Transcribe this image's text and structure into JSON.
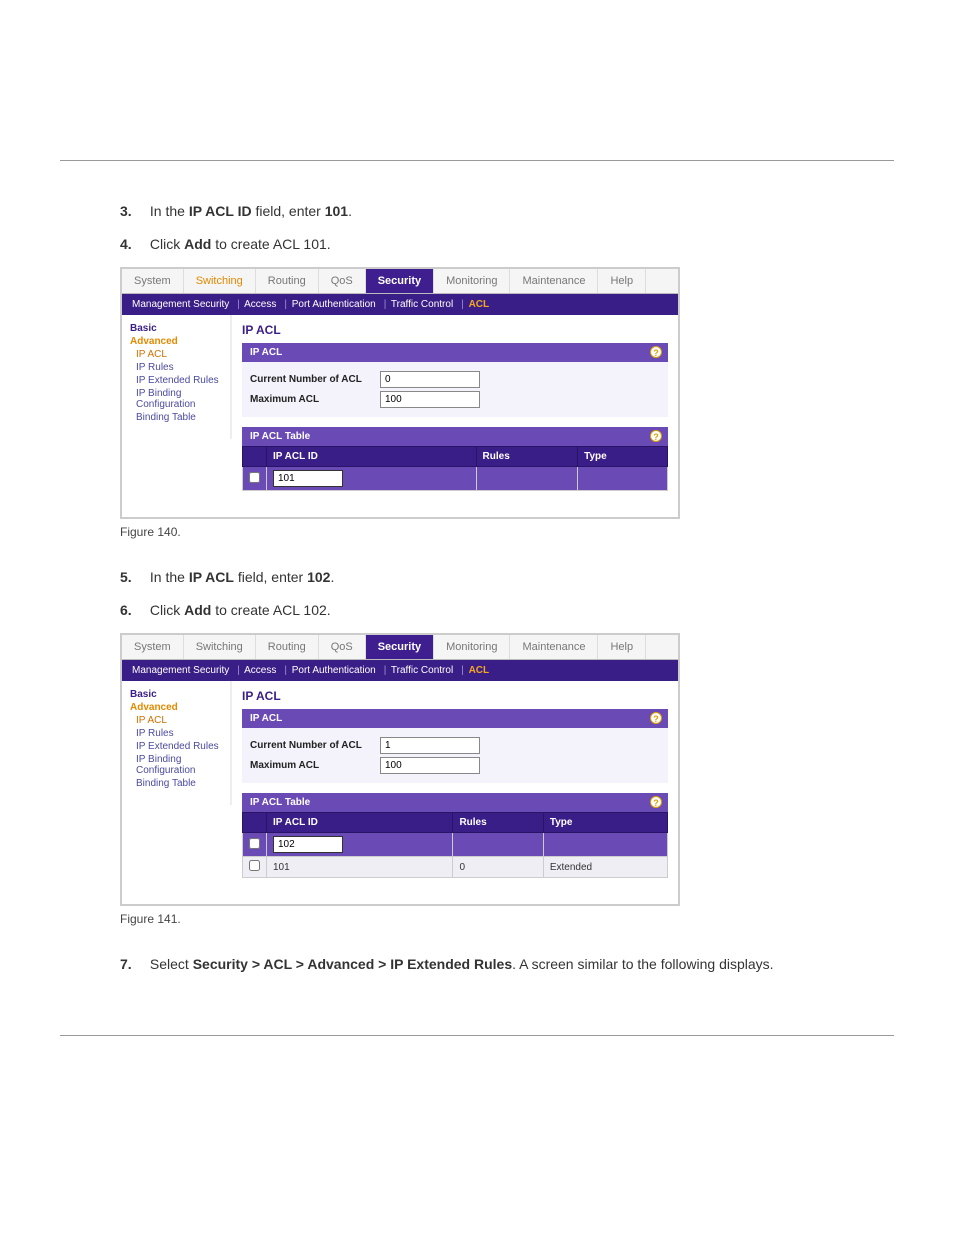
{
  "meta": {
    "active_tab": "Security",
    "sub_active": "ACL",
    "content_title": "IP ACL"
  },
  "tabs": [
    "System",
    "Switching",
    "Routing",
    "QoS",
    "Security",
    "Monitoring",
    "Maintenance",
    "Help"
  ],
  "subnav": [
    "Management Security",
    "Access",
    "Port Authentication",
    "Traffic Control",
    "ACL"
  ],
  "sidebar": {
    "basic": "Basic",
    "advanced": "Advanced",
    "items": [
      "IP ACL",
      "IP Rules",
      "IP Extended Rules",
      "IP Binding Configuration",
      "Binding Table"
    ],
    "active_item": "IP ACL"
  },
  "panel_ipacl": {
    "title": "IP ACL",
    "fields": {
      "current_label": "Current Number of ACL",
      "max_label": "Maximum ACL"
    }
  },
  "panel_table": {
    "title": "IP ACL Table",
    "columns": {
      "id": "IP ACL ID",
      "rules": "Rules",
      "type": "Type"
    }
  },
  "fig1": {
    "orange_tab": "Switching",
    "current": "0",
    "max": "100",
    "edit_id": "101",
    "rows": []
  },
  "fig2": {
    "orange_tab": "",
    "current": "1",
    "max": "100",
    "edit_id": "102",
    "rows": [
      {
        "id": "101",
        "rules": "0",
        "type": "Extended"
      }
    ]
  },
  "doc": {
    "step3_num": "3.",
    "step3_a": "In the ",
    "step3_b": "IP ACL ID",
    "step3_c": " field, enter ",
    "step3_d": "101",
    "step3_e": ".",
    "step4_num": "4.",
    "step4_a": "Click ",
    "step4_b": "Add",
    "step4_c": " to create ACL 101.",
    "fig1_label": "Figure 140.",
    "step5_num": "5.",
    "step5_a": "In the ",
    "step5_b": "IP ACL",
    "step5_c": " field, enter ",
    "step5_d": "102",
    "step5_e": ".",
    "step6_num": "6.",
    "step6_a": "Click ",
    "step6_b": "Add",
    "step6_c": " to create ACL 102.",
    "fig2_label": "Figure 141.",
    "step7_num": "7.",
    "step7_a": "Select ",
    "step7_b": "Security > ACL > Advanced > IP Extended Rules",
    "step7_c": ". A screen similar to the following displays."
  }
}
